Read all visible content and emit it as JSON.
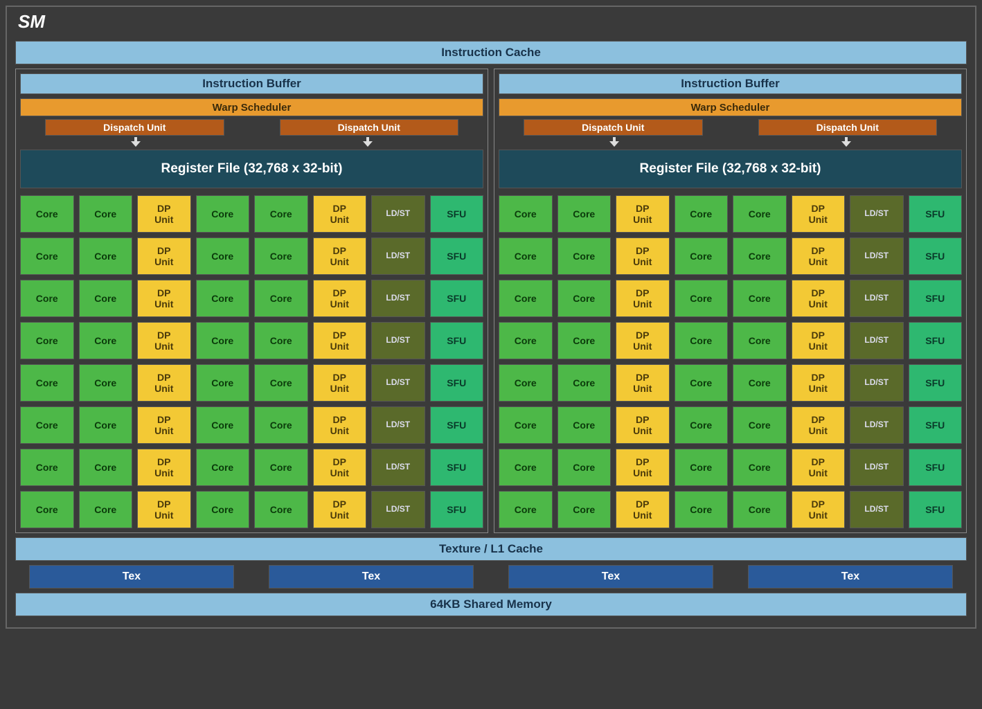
{
  "title": "SM",
  "instruction_cache": "Instruction Cache",
  "partition": {
    "instruction_buffer": "Instruction Buffer",
    "warp_scheduler": "Warp Scheduler",
    "dispatch_unit": "Dispatch Unit",
    "register_file": "Register File (32,768 x 32-bit)",
    "row_pattern": [
      "Core",
      "Core",
      "DP\nUnit",
      "Core",
      "Core",
      "DP\nUnit",
      "LD/ST",
      "SFU"
    ],
    "row_types": [
      "core",
      "core",
      "dp",
      "core",
      "core",
      "dp",
      "ldst",
      "sfu"
    ],
    "rows": 8
  },
  "partition_count": 2,
  "texture_l1": "Texture / L1 Cache",
  "tex_label": "Tex",
  "tex_count": 4,
  "shared_memory": "64KB Shared Memory"
}
